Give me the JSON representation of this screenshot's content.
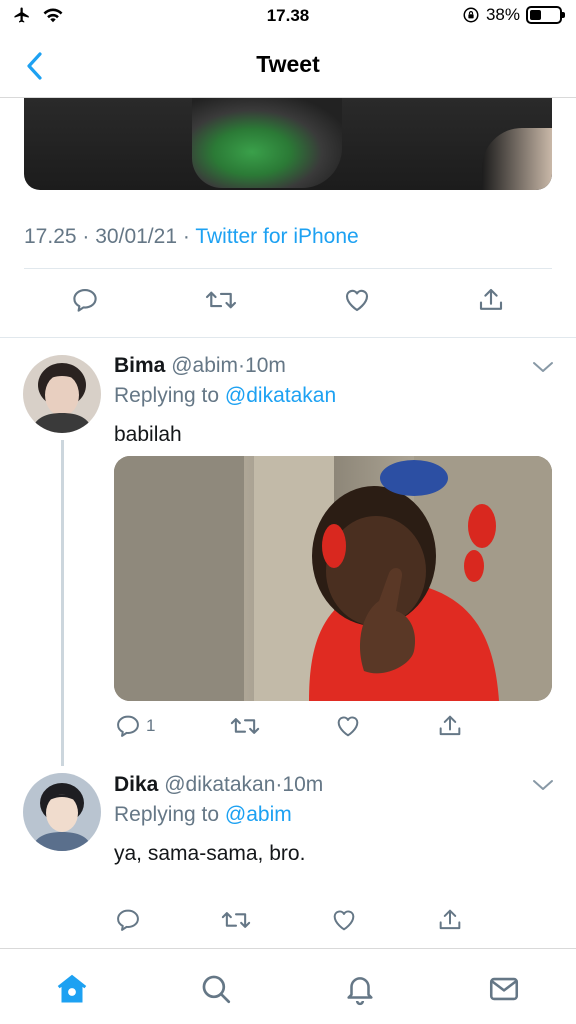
{
  "status_bar": {
    "time": "17.38",
    "battery_percent": "38%",
    "battery_level": 0.38,
    "icons": [
      "airplane-icon",
      "wifi-icon",
      "orientation-lock-icon",
      "battery-icon"
    ]
  },
  "nav": {
    "title": "Tweet",
    "back_icon": "chevron-left-icon"
  },
  "tweet": {
    "time": "17.25",
    "separator": "·",
    "date": "30/01/21",
    "source": "Twitter for iPhone"
  },
  "replies": [
    {
      "name": "Bima",
      "handle": "@abim",
      "dot": "·",
      "age": "10m",
      "replying_to_label": "Replying to",
      "replying_to": "@dikatakan",
      "text": "babilah",
      "reply_count": "1"
    },
    {
      "name": "Dika",
      "handle": "@dikatakan",
      "dot": "·",
      "age": "10m",
      "replying_to_label": "Replying to",
      "replying_to": "@abim",
      "text": "ya, sama-sama, bro.",
      "reply_count": ""
    }
  ],
  "tab_bar": {
    "tabs": [
      "home-icon",
      "search-icon",
      "notifications-icon",
      "messages-icon"
    ],
    "active": "home-icon"
  },
  "colors": {
    "accent": "#1da1f2",
    "secondary_text": "#657786",
    "divider": "#e1e8ed"
  }
}
